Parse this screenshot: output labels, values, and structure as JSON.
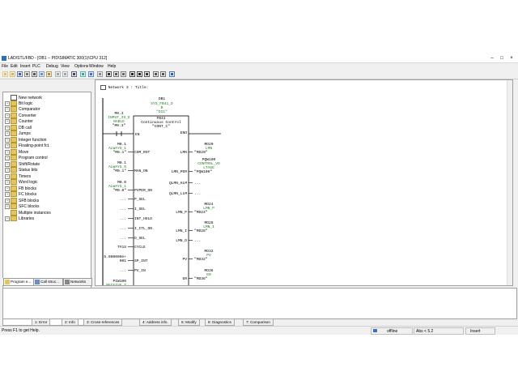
{
  "window": {
    "title": "LAD/STL/FBD  - [OB1 -- PID\\SIMATIC 300(1)\\CPU 312]"
  },
  "menu": [
    "File",
    "Edit",
    "Insert",
    "PLC",
    "Debug",
    "View",
    "Options",
    "Window",
    "Help"
  ],
  "tree": {
    "items": [
      {
        "label": "New network",
        "icon": "network-icon",
        "expand": false
      },
      {
        "label": "Bit logic",
        "icon": "folder-icon",
        "expand": true
      },
      {
        "label": "Comparator",
        "icon": "folder-icon",
        "expand": true
      },
      {
        "label": "Converter",
        "icon": "folder-icon",
        "expand": true
      },
      {
        "label": "Counter",
        "icon": "folder-icon",
        "expand": true
      },
      {
        "label": "DB call",
        "icon": "folder-icon",
        "expand": true
      },
      {
        "label": "Jumps",
        "icon": "folder-icon",
        "expand": true
      },
      {
        "label": "Integer function",
        "icon": "folder-icon",
        "expand": true
      },
      {
        "label": "Floating-point fct.",
        "icon": "folder-icon",
        "expand": true
      },
      {
        "label": "Move",
        "icon": "folder-icon",
        "expand": true
      },
      {
        "label": "Program control",
        "icon": "folder-icon",
        "expand": true
      },
      {
        "label": "Shift/Rotate",
        "icon": "folder-icon",
        "expand": true
      },
      {
        "label": "Status bits",
        "icon": "folder-icon",
        "expand": true
      },
      {
        "label": "Timers",
        "icon": "folder-icon",
        "expand": true
      },
      {
        "label": "Word logic",
        "icon": "folder-icon",
        "expand": true
      },
      {
        "label": "FB blocks",
        "icon": "folder-icon",
        "expand": true
      },
      {
        "label": "FC blocks",
        "icon": "folder-icon",
        "expand": true
      },
      {
        "label": "SFB blocks",
        "icon": "folder-icon",
        "expand": true
      },
      {
        "label": "SFC blocks",
        "icon": "folder-icon",
        "expand": true
      },
      {
        "label": "Multiple instances",
        "icon": "folder-icon",
        "expand": false
      },
      {
        "label": "Libraries",
        "icon": "folder-icon",
        "expand": true
      }
    ]
  },
  "pane_tabs": [
    "Program e...",
    "Call struc...",
    "Networks"
  ],
  "network": {
    "header": "Network 3 : Title:",
    "instance_db": [
      "DB1",
      "SYS_FB41_D",
      "B",
      "\"DI1\""
    ],
    "block": [
      "FB41",
      "Continuous Control",
      "\"CONT_C\""
    ],
    "en_var": [
      "M0.3",
      "INPUT_IS_E",
      "NABLE",
      "\"M0.3\""
    ],
    "inputs": [
      {
        "pin": "COM_RST",
        "var": [
          "M0.1",
          "ALWAYS_1",
          "\"M0.1\""
        ]
      },
      {
        "pin": "MAN_ON",
        "var": [
          "M0.1",
          "ALWAYS_0",
          "\"M0.1\""
        ]
      },
      {
        "pin": "PVPER_ON",
        "var": [
          "M0.0",
          "ALWAYS_1",
          "\"M0.0\""
        ]
      },
      {
        "pin": "P_SEL",
        "var": [
          "..."
        ]
      },
      {
        "pin": "I_SEL",
        "var": [
          "..."
        ]
      },
      {
        "pin": "INT_HOLD",
        "var": [
          "..."
        ]
      },
      {
        "pin": "I_ITL_ON",
        "var": [
          "..."
        ]
      },
      {
        "pin": "D_SEL",
        "var": [
          "..."
        ]
      },
      {
        "pin": "CYCLE",
        "var": [
          "T#1S"
        ]
      },
      {
        "pin": "SP_INT",
        "var": [
          "5.000000e+",
          "001"
        ]
      },
      {
        "pin": "PV_IN",
        "var": [
          "..."
        ]
      },
      {
        "pin": "",
        "var": [
          "PIW100",
          "RECEIVE_T"
        ]
      }
    ],
    "outputs": [
      {
        "pin": "ENO",
        "var": []
      },
      {
        "pin": "LMN",
        "var": [
          "MD20",
          "LMN",
          "\"MD20\""
        ]
      },
      {
        "pin": "LMN_PER",
        "var": [
          "PQW100",
          "CONTROL_VO",
          "LTAGE",
          "\"PQW100\""
        ]
      },
      {
        "pin": "QLMN_HLM",
        "var": [
          "..."
        ]
      },
      {
        "pin": "QLMN_LLM",
        "var": [
          "..."
        ]
      },
      {
        "pin": "LMN_P",
        "var": [
          "MD24",
          "LMN_P",
          "\"MD24\""
        ]
      },
      {
        "pin": "LMN_I",
        "var": [
          "MD28",
          "LMN_I",
          "\"MD28\""
        ]
      },
      {
        "pin": "LMN_D",
        "var": [
          "..."
        ]
      },
      {
        "pin": "PV",
        "var": [
          "MD32",
          "PV",
          "\"MD32\""
        ]
      },
      {
        "pin": "ER",
        "var": [
          "MD36",
          "ER",
          "\"MD36\""
        ]
      }
    ],
    "en_pin": "EN"
  },
  "bottom_tabs": [
    "1: Error",
    "2: Info",
    "3: Cross-references",
    "4: Address info.",
    "5: Modify",
    "6: Diagnostics",
    "7: Comparison"
  ],
  "status": {
    "help": "Press F1 to get Help.",
    "mode": "offline",
    "position": "Abs < 5.2",
    "insert": "Insert"
  },
  "colors": {
    "address_green": "#1f7f1f",
    "offline_icon": "#3a6fc8"
  }
}
